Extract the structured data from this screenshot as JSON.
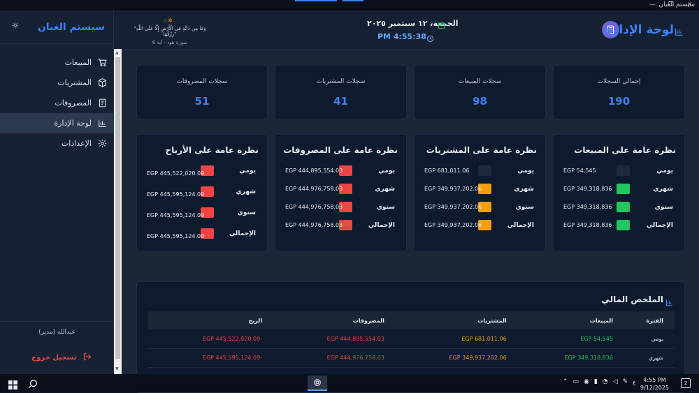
{
  "window": {
    "title": "سيستم الغبان"
  },
  "sidebar": {
    "brand": "سيستم الغبان",
    "items": [
      {
        "label": "المبيعات",
        "icon": "cart-icon",
        "active": false
      },
      {
        "label": "المشتريات",
        "icon": "box-icon",
        "active": false
      },
      {
        "label": "المصروفات",
        "icon": "receipt-icon",
        "active": false
      },
      {
        "label": "لوحة الإدارة",
        "icon": "bar-chart-icon",
        "active": true
      },
      {
        "label": "الإعدادات",
        "icon": "gear-icon",
        "active": false
      }
    ],
    "user": "عبدالله (مدير)",
    "logout": "تسجيل خروج"
  },
  "header": {
    "title": "لوحة الإدارة",
    "date": "الجمعة، ١٢ سبتمبر ٢٠٢٥",
    "time": "PM 4:55:38",
    "verse": "\"وَمَا مِن دَابَّةٍ فِي الْأَرْضِ إِلَّا عَلَى اللَّهِ رِزْقُهَا\"",
    "verse_ref": "سورة هود - آية 6"
  },
  "stats": [
    {
      "label": "إجمالي السجلات",
      "value": "190"
    },
    {
      "label": "سجلات المبيعات",
      "value": "98"
    },
    {
      "label": "سجلات المشتريات",
      "value": "41"
    },
    {
      "label": "سجلات المصروفات",
      "value": "51"
    }
  ],
  "overviews": [
    {
      "title": "نظرة عامة على المبيعات",
      "rows": [
        {
          "label": "يومي",
          "value": "EGP 54,545",
          "color": "#1e293b"
        },
        {
          "label": "شهري",
          "value": "EGP 349,318,836",
          "color": "#22c55e"
        },
        {
          "label": "سنوي",
          "value": "EGP 349,318,836",
          "color": "#22c55e"
        },
        {
          "label": "الإجمالي",
          "value": "EGP 349,318,836",
          "color": "#22c55e"
        }
      ]
    },
    {
      "title": "نظرة عامة على المشتريات",
      "rows": [
        {
          "label": "يومي",
          "value": "EGP 681,011.06",
          "color": "#1e293b"
        },
        {
          "label": "شهري",
          "value": "EGP 349,937,202.06",
          "color": "#f59e0b"
        },
        {
          "label": "سنوي",
          "value": "EGP 349,937,202.06",
          "color": "#f59e0b"
        },
        {
          "label": "الإجمالي",
          "value": "EGP 349,937,202.06",
          "color": "#f59e0b"
        }
      ]
    },
    {
      "title": "نظرة عامة على المصروفات",
      "rows": [
        {
          "label": "يومي",
          "value": "EGP 444,895,554.03",
          "color": "#ef4444"
        },
        {
          "label": "شهري",
          "value": "EGP 444,976,758.03",
          "color": "#ef4444"
        },
        {
          "label": "سنوي",
          "value": "EGP 444,976,758.03",
          "color": "#ef4444"
        },
        {
          "label": "الإجمالي",
          "value": "EGP 444,976,758.03",
          "color": "#ef4444"
        }
      ]
    },
    {
      "title": "نظرة عامة على الأرباح",
      "rows": [
        {
          "label": "يومي",
          "value": "EGP 445,522,020.09",
          "color": "#ef4444"
        },
        {
          "label": "شهري",
          "value": "EGP 445,595,124.09",
          "color": "#ef4444"
        },
        {
          "label": "سنوي",
          "value": "EGP 445,595,124.09",
          "color": "#ef4444"
        },
        {
          "label": "الإجمالي",
          "value": "EGP 445,595,124.09",
          "color": "#ef4444"
        }
      ]
    }
  ],
  "summary": {
    "title": "الملخص المالي",
    "headers": [
      "الفترة",
      "المبيعات",
      "المشتريات",
      "المصروفات",
      "الربح"
    ],
    "rows": [
      [
        "يومي",
        "EGP 54,545",
        "EGP 681,011.06",
        "EGP 444,895,554.03",
        "-EGP 445,522,020.09"
      ],
      [
        "شهري",
        "EGP 349,318,836",
        "EGP 349,937,202.06",
        "EGP 444,976,758.03",
        "-EGP 445,595,124.09"
      ]
    ]
  },
  "taskbar": {
    "time": "4:55 PM",
    "date": "9/12/2025",
    "lang": "ع",
    "notifications": "2"
  }
}
